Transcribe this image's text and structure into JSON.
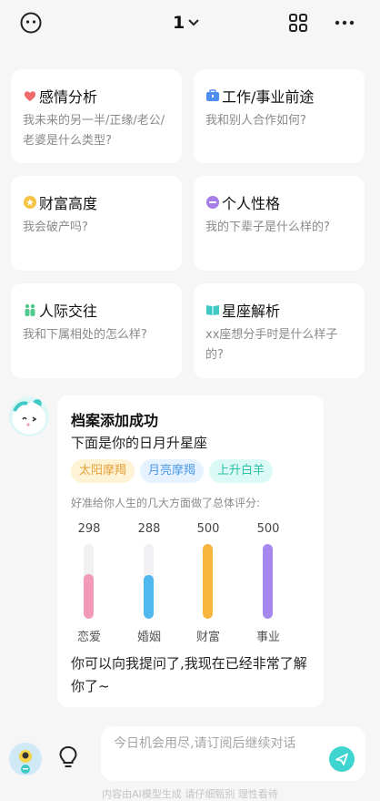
{
  "header": {
    "title": "1",
    "menu_icon": "face-icon",
    "grid_icon": "grid-icon",
    "more_icon": "more-icon"
  },
  "cards": [
    {
      "title": "感情分析",
      "desc": "我未来的另一半/正缘/老公/老婆是什么类型?",
      "icon": "heart-icon",
      "color": "#ef6b6b"
    },
    {
      "title": "工作/事业前途",
      "desc": "我和别人合作如何?",
      "icon": "briefcase-icon",
      "color": "#4d8ef0"
    },
    {
      "title": "财富高度",
      "desc": "我会破产吗?",
      "icon": "coin-icon",
      "color": "#f5c342"
    },
    {
      "title": "个人性格",
      "desc": "我的下辈子是什么样的?",
      "icon": "smile-icon",
      "color": "#a77de8"
    },
    {
      "title": "人际交往",
      "desc": "我和下属相处的怎么样?",
      "icon": "people-icon",
      "color": "#4fc98c"
    },
    {
      "title": "星座解析",
      "desc": "xx座想分手时是什么样子的?",
      "icon": "book-icon",
      "color": "#3ec9c4"
    }
  ],
  "message": {
    "title": "档案添加成功",
    "subtitle": "下面是你的日月升星座",
    "tags": {
      "sun": "太阳摩羯",
      "moon": "月亮摩羯",
      "rising": "上升白羊"
    },
    "note": "好准给你人生的几大方面做了总体评分:",
    "scores": [
      {
        "label": "恋爱",
        "value": "298",
        "level": 0.6,
        "color": "#f49ab9"
      },
      {
        "label": "婚姻",
        "value": "288",
        "level": 0.58,
        "color": "#4fb8ef"
      },
      {
        "label": "财富",
        "value": "500",
        "level": 1.0,
        "color": "#f7b63b"
      },
      {
        "label": "事业",
        "value": "500",
        "level": 1.0,
        "color": "#a687f0"
      }
    ],
    "closing": "你可以向我提问了,我现在已经非常了解你了~"
  },
  "input": {
    "placeholder": "今日机会用尽,请订阅后继续对话"
  },
  "footer": {
    "note": "内容由AI模型生成 请仔细甄别 理性看待"
  }
}
